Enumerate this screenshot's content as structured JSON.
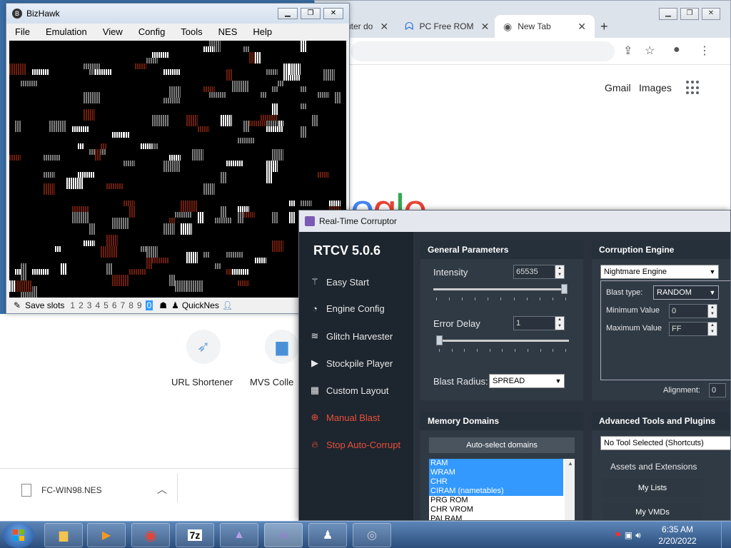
{
  "chrome": {
    "tabs": [
      {
        "label": "uter do"
      },
      {
        "label": "PC Free ROM"
      },
      {
        "label": "New Tab"
      }
    ],
    "new_tab_symbol": "+",
    "links": {
      "gmail": "Gmail",
      "images": "Images"
    },
    "logo_partial": "ogle",
    "shortcuts": [
      {
        "label": "URL Shortener",
        "icon": "link-icon"
      },
      {
        "label": "MVS Colle",
        "icon": "folder-icon"
      }
    ],
    "download": {
      "filename": "FC-WIN98.NES"
    }
  },
  "bizhawk": {
    "title": "BizHawk",
    "menu": [
      "File",
      "Emulation",
      "View",
      "Config",
      "Tools",
      "NES",
      "Help"
    ],
    "status": {
      "save_slots_label": "Save slots",
      "slots": [
        "1",
        "2",
        "3",
        "4",
        "5",
        "6",
        "7",
        "8",
        "9",
        "0"
      ],
      "selected_slot": "0",
      "core": "QuickNes"
    }
  },
  "rtc": {
    "title": "Real-Time Corruptor",
    "version": "RTCV 5.0.6",
    "nav": [
      {
        "label": "Easy Start",
        "icon": "wand-icon"
      },
      {
        "label": "Engine Config",
        "icon": "gauge-icon"
      },
      {
        "label": "Glitch Harvester",
        "icon": "layers-icon"
      },
      {
        "label": "Stockpile Player",
        "icon": "play-icon"
      },
      {
        "label": "Custom Layout",
        "icon": "grid-icon"
      },
      {
        "label": "Manual Blast",
        "icon": "crosshair-icon"
      },
      {
        "label": "Stop Auto-Corrupt",
        "icon": "flame-icon"
      }
    ],
    "general": {
      "header": "General Parameters",
      "intensity_label": "Intensity",
      "intensity_value": "65535",
      "intensity_level": 1.0,
      "error_delay_label": "Error Delay",
      "error_delay_value": "1",
      "error_delay_level": 0.0,
      "blast_radius_label": "Blast Radius:",
      "blast_radius_value": "SPREAD"
    },
    "engine": {
      "header": "Corruption Engine",
      "engine_value": "Nightmare Engine",
      "blast_type_label": "Blast type:",
      "blast_type_value": "RANDOM",
      "min_label": "Minimum Value",
      "min_value": "0",
      "max_label": "Maximum Value",
      "max_value": "FF",
      "alignment_label": "Alignment:",
      "alignment_value": "0"
    },
    "memory": {
      "header": "Memory Domains",
      "autoselect": "Auto-select domains",
      "domains": [
        {
          "name": "RAM",
          "selected": true
        },
        {
          "name": "WRAM",
          "selected": true
        },
        {
          "name": "CHR",
          "selected": true
        },
        {
          "name": "CIRAM (nametables)",
          "selected": true
        },
        {
          "name": "PRG ROM",
          "selected": false
        },
        {
          "name": "CHR VROM",
          "selected": false
        },
        {
          "name": "PALRAM",
          "selected": false
        }
      ]
    },
    "advanced": {
      "header": "Advanced Tools and Plugins",
      "tool_select": "No Tool Selected (Shortcuts)",
      "assets": "Assets and Extensions",
      "my_lists": "My Lists",
      "my_vmds": "My VMDs"
    }
  },
  "taskbar": {
    "items": [
      "folder-icon",
      "media-icon",
      "chrome-icon",
      "7zip-icon",
      "app-icon",
      "rtc-icon",
      "tux-icon",
      "speaker-icon"
    ],
    "sevenzip_label": "7z",
    "time": "6:35 AM",
    "date": "2/20/2022"
  }
}
